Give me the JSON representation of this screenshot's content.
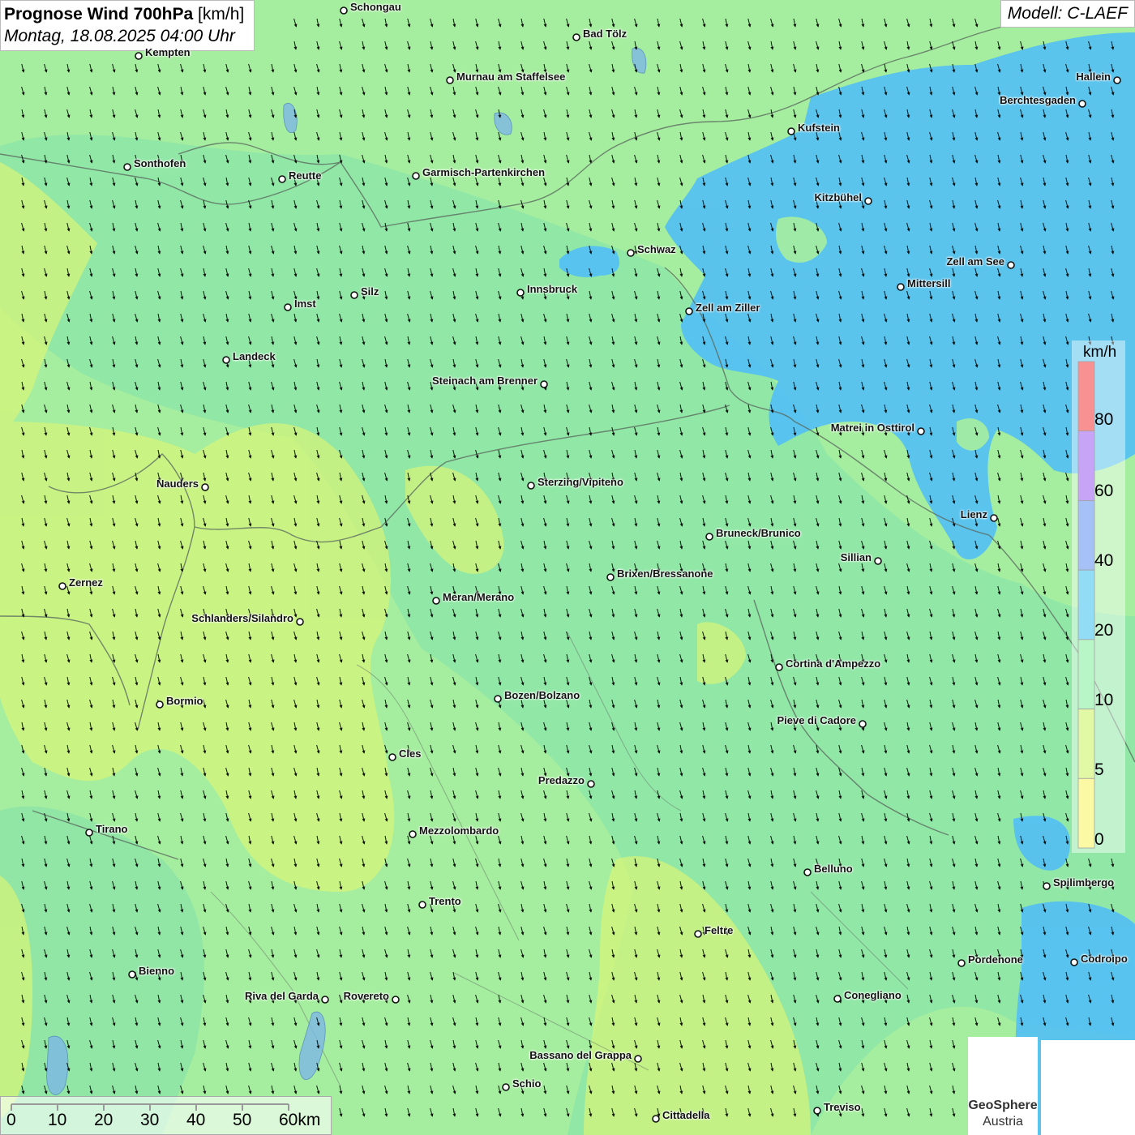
{
  "title": {
    "main": "Prognose Wind 700hPa",
    "unit": "[km/h]",
    "datetime": "Montag, 18.08.2025 04:00 Uhr"
  },
  "model": "Modell: C-LAEF",
  "legend": {
    "unit": "km/h",
    "labels": [
      "80",
      "60",
      "40",
      "20",
      "10",
      "5",
      "0"
    ],
    "colors": {
      "80": "#f23a3a",
      "60": "#9b5af0",
      "40": "#5b8fef",
      "20": "#3bbfef",
      "10": "#7fee9a",
      "5": "#c9f55a",
      "0": "#f8f55a"
    }
  },
  "scalebar": {
    "labels": [
      "0",
      "10",
      "20",
      "30",
      "40",
      "50",
      "60km"
    ]
  },
  "logos": {
    "geosphere": [
      "GeoSphere",
      "Austria"
    ]
  },
  "cities": [
    {
      "name": "Schongau"
    },
    {
      "name": "Kempten"
    },
    {
      "name": "Bad Tölz"
    },
    {
      "name": "Murnau am Staffelsee"
    },
    {
      "name": "Hallein"
    },
    {
      "name": "Berchtesgaden"
    },
    {
      "name": "Kufstein"
    },
    {
      "name": "Sonthofen"
    },
    {
      "name": "Reutte"
    },
    {
      "name": "Garmisch-Partenkirchen"
    },
    {
      "name": "Kitzbühel"
    },
    {
      "name": "Schwaz"
    },
    {
      "name": "Zell am See"
    },
    {
      "name": "Mittersill"
    },
    {
      "name": "Innsbruck"
    },
    {
      "name": "Silz"
    },
    {
      "name": "Imst"
    },
    {
      "name": "Zell am Ziller"
    },
    {
      "name": "Landeck"
    },
    {
      "name": "Steinach am Brenner"
    },
    {
      "name": "Matrei in Osttirol"
    },
    {
      "name": "Nauders"
    },
    {
      "name": "Sterzing/Vipiteno"
    },
    {
      "name": "Lienz"
    },
    {
      "name": "Bruneck/Brunico"
    },
    {
      "name": "Sillian"
    },
    {
      "name": "Zernez"
    },
    {
      "name": "Brixen/Bressanone"
    },
    {
      "name": "Meran/Merano"
    },
    {
      "name": "Schlanders/Silandro"
    },
    {
      "name": "Cortina d'Ampezzo"
    },
    {
      "name": "Bozen/Bolzano"
    },
    {
      "name": "Bormio"
    },
    {
      "name": "Pieve di Cadore"
    },
    {
      "name": "Cles"
    },
    {
      "name": "Predazzo"
    },
    {
      "name": "Tirano"
    },
    {
      "name": "Mezzolombardo"
    },
    {
      "name": "Belluno"
    },
    {
      "name": "Spilimbergo"
    },
    {
      "name": "Trento"
    },
    {
      "name": "Feltre"
    },
    {
      "name": "Pordenone"
    },
    {
      "name": "Codroipo"
    },
    {
      "name": "Bienno"
    },
    {
      "name": "Riva del Garda"
    },
    {
      "name": "Rovereto"
    },
    {
      "name": "Conegliano"
    },
    {
      "name": "Bassano del Grappa"
    },
    {
      "name": "Schio"
    },
    {
      "name": "Treviso"
    },
    {
      "name": "Cittadella"
    }
  ]
}
